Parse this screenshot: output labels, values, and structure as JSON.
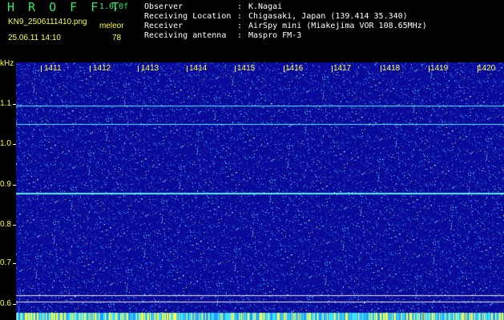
{
  "header": {
    "app_title": "H R O F F T",
    "version": "1.0.0f",
    "filename": "KN9_2506111410.png",
    "app_mode": "meleor",
    "datetime": "25.06.11 14:10",
    "count": "78"
  },
  "info": [
    {
      "key": "Observer",
      "value": "K.Nagai"
    },
    {
      "key": "Receiving Location",
      "value": "Chigasaki, Japan (139.414 35.340)"
    },
    {
      "key": "Receiver",
      "value": "AirSpy mini (Miakejima VOR 108.65MHz)"
    },
    {
      "key": "Receiving antenna",
      "value": "Maspro FM-3"
    }
  ],
  "y_axis": {
    "unit": "kHz",
    "ticks": [
      "1.1",
      "1.0",
      "0.9",
      "0.8",
      "0.7",
      "0.6"
    ]
  },
  "x_axis": {
    "ticks": [
      "1411",
      "1412",
      "1413",
      "1414",
      "1415",
      "1416",
      "1417",
      "1418",
      "1419",
      "1420"
    ]
  },
  "colors": {
    "background": "#0a0a8c",
    "text_yellow": "#ffff3c",
    "title_green": "#2ee86a",
    "signal": "#55eeff"
  }
}
